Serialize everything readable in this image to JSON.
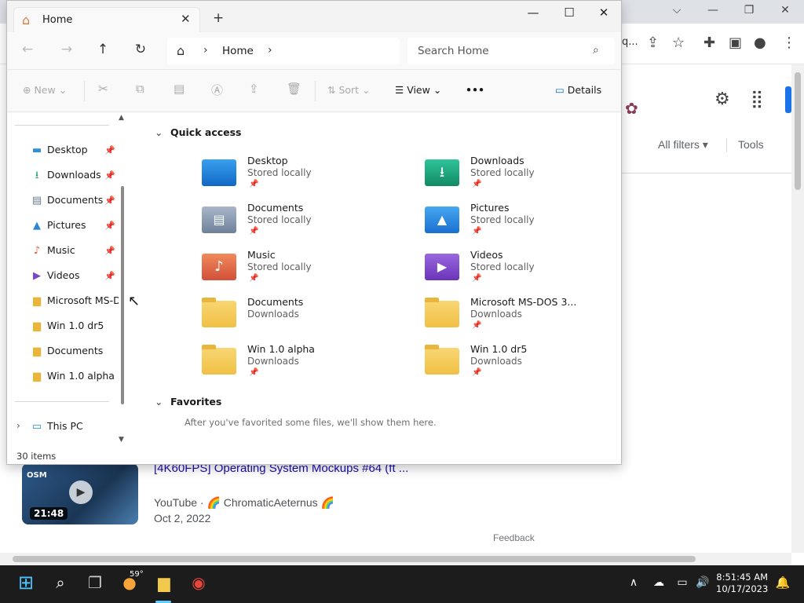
{
  "explorer": {
    "tab_title": "Home",
    "breadcrumb_label": "Home",
    "search_placeholder": "Search Home",
    "commands": {
      "new": "New",
      "sort": "Sort",
      "view": "View",
      "more": "•••",
      "details": "Details"
    },
    "sidebar": {
      "pinned": [
        {
          "label": "Desktop",
          "icon": "desktop-icon"
        },
        {
          "label": "Downloads",
          "icon": "download-icon"
        },
        {
          "label": "Documents",
          "icon": "documents-icon"
        },
        {
          "label": "Pictures",
          "icon": "pictures-icon"
        },
        {
          "label": "Music",
          "icon": "music-icon"
        },
        {
          "label": "Videos",
          "icon": "videos-icon"
        }
      ],
      "recent": [
        "Microsoft MS-D",
        "Win 1.0 dr5",
        "Documents",
        "Win 1.0 alpha"
      ],
      "this_pc": "This PC"
    },
    "status": "30 items",
    "quick_access": {
      "heading": "Quick access",
      "items": [
        {
          "name": "Desktop",
          "sub": "Stored locally",
          "icon": "desktop-folder-icon"
        },
        {
          "name": "Downloads",
          "sub": "Stored locally",
          "icon": "downloads-folder-icon"
        },
        {
          "name": "Documents",
          "sub": "Stored locally",
          "icon": "documents-folder-icon"
        },
        {
          "name": "Pictures",
          "sub": "Stored locally",
          "icon": "pictures-folder-icon"
        },
        {
          "name": "Music",
          "sub": "Stored locally",
          "icon": "music-folder-icon"
        },
        {
          "name": "Videos",
          "sub": "Stored locally",
          "icon": "videos-folder-icon"
        },
        {
          "name": "Documents",
          "sub": "Downloads",
          "icon": "folder-icon"
        },
        {
          "name": "Microsoft MS-DOS 3...",
          "sub": "Downloads",
          "icon": "folder-icon"
        },
        {
          "name": "Win 1.0 alpha",
          "sub": "Downloads",
          "icon": "folder-icon"
        },
        {
          "name": "Win 1.0 dr5",
          "sub": "Downloads",
          "icon": "folder-icon"
        }
      ]
    },
    "favorites": {
      "heading": "Favorites",
      "note": "After you've favorited some files, we'll show them here."
    }
  },
  "browser_bg": {
    "addr_fragment": "q...",
    "all_filters": "All filters",
    "tools": "Tools",
    "video": {
      "duration": "21:48",
      "thumb_text": "OSM",
      "title": "[4K60FPS] Operating System Mockups #64 (ft ...",
      "source": "YouTube · 🌈 ChromaticAeternus 🌈",
      "date": "Oct 2, 2022"
    },
    "feedback": "Feedback"
  },
  "taskbar": {
    "weather_temp": "59°",
    "time": "8:51:45 AM",
    "date": "10/17/2023"
  }
}
